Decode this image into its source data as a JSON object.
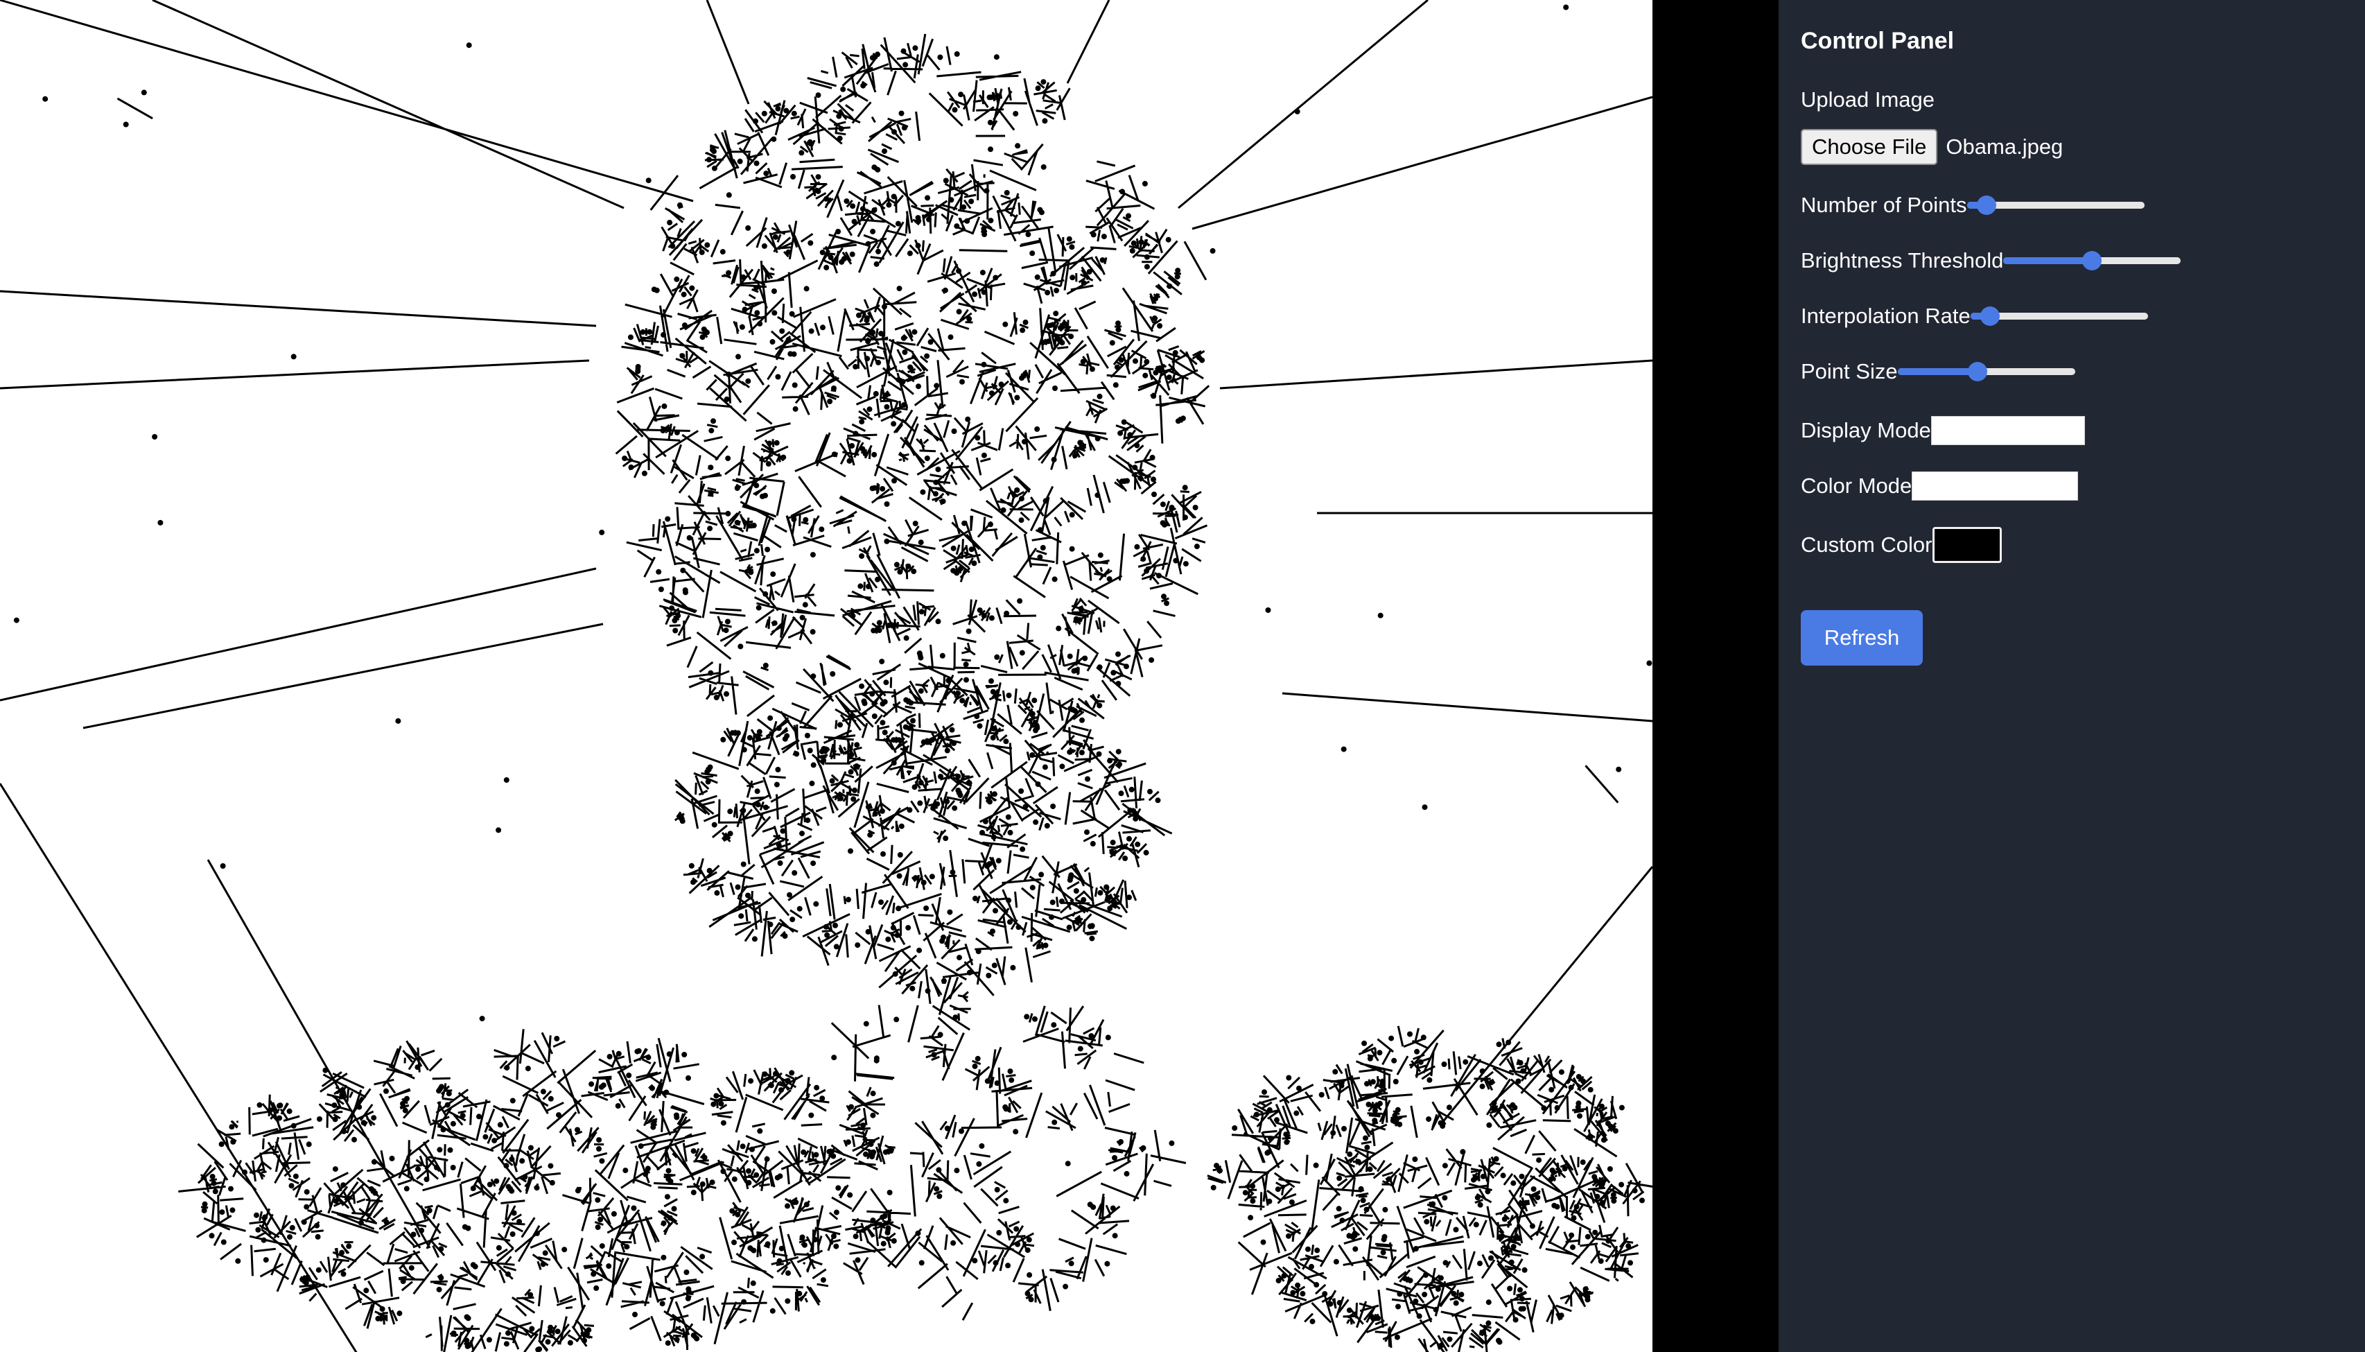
{
  "panel": {
    "title": "Control Panel",
    "upload_label": "Upload Image",
    "choose_file_label": "Choose File",
    "file_name": "Obama.jpeg",
    "sliders": [
      {
        "label": "Number of Points",
        "value_fraction": 0.11
      },
      {
        "label": "Brightness Threshold",
        "value_fraction": 0.5
      },
      {
        "label": "Interpolation Rate",
        "value_fraction": 0.11
      },
      {
        "label": "Point Size",
        "value_fraction": 0.45
      }
    ],
    "display_mode_label": "Display Mode",
    "display_mode_value": "",
    "color_mode_label": "Color Mode",
    "color_mode_value": "",
    "custom_color_label": "Custom Color",
    "custom_color_value": "#000000",
    "refresh_label": "Refresh"
  },
  "colors": {
    "panel_bg": "#222734",
    "accent": "#4a7be5",
    "canvas_bg": "#ffffff",
    "stroke": "#000000"
  }
}
